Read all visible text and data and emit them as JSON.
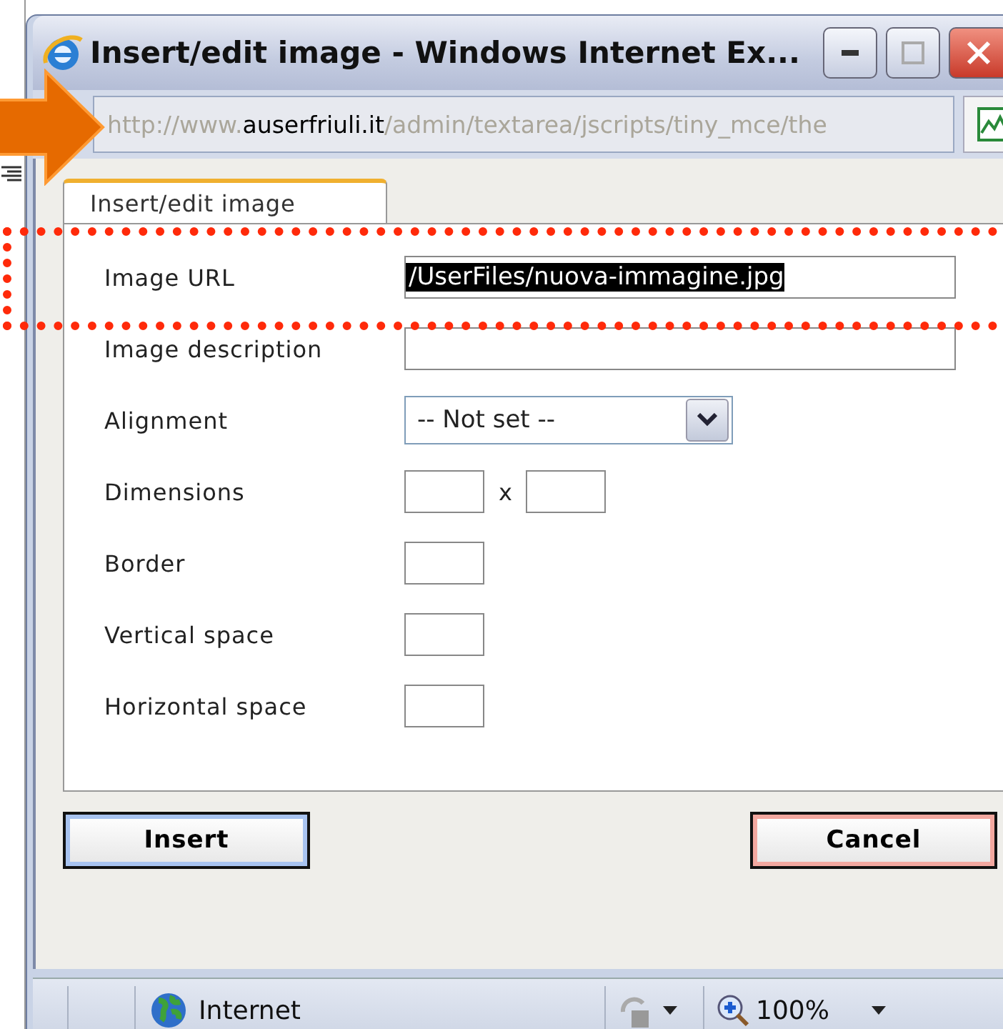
{
  "window": {
    "title": "Insert/edit image - Windows Internet Ex..."
  },
  "address_bar": {
    "parts": [
      {
        "text": "http://www.",
        "strong": false
      },
      {
        "text": "auserfriuli.it",
        "strong": true
      },
      {
        "text": "/admin/textarea/jscripts/tiny_mce/the",
        "strong": false
      }
    ]
  },
  "tabs": [
    {
      "label": "Insert/edit image",
      "selected": true
    }
  ],
  "fields": [
    {
      "kind": "text",
      "label": "Image URL",
      "value": "/UserFiles/nuova-immagine.jpg",
      "highlighted": true
    },
    {
      "kind": "text",
      "label": "Image description"
    },
    {
      "kind": "select",
      "label": "Alignment",
      "value": "-- Not set --"
    },
    {
      "kind": "dimensions",
      "label": "Dimensions",
      "separator": "x"
    },
    {
      "kind": "small",
      "label": "Border"
    },
    {
      "kind": "small",
      "label": "Vertical space"
    },
    {
      "kind": "small",
      "label": "Horizontal space"
    }
  ],
  "buttons": [
    {
      "kind": "primary",
      "label": "Insert"
    },
    {
      "kind": "cancel",
      "label": "Cancel"
    }
  ],
  "status_bar": {
    "zone": "Internet",
    "zoom": "100%"
  }
}
